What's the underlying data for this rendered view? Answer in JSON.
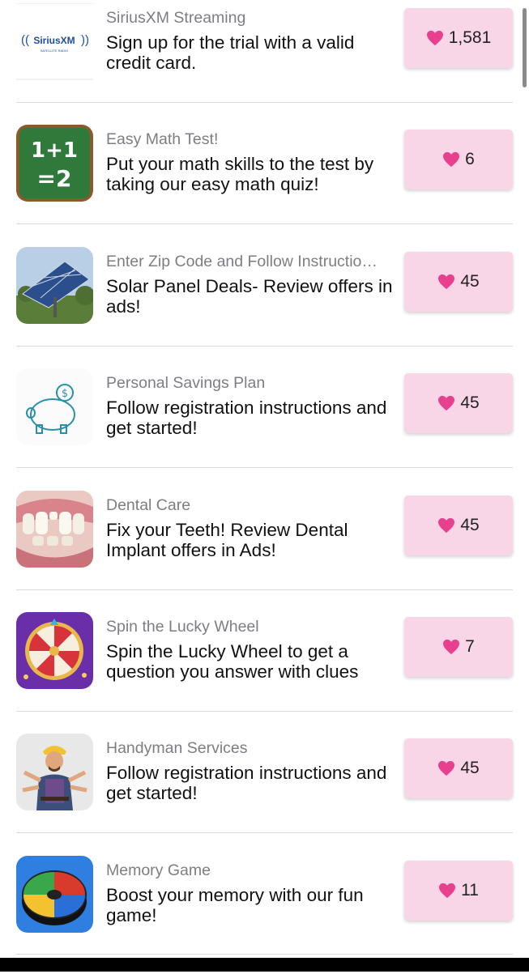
{
  "offers": [
    {
      "category": "SiriusXM Streaming",
      "description": "Sign up for the trial with a valid credit card.",
      "likes": "1,581",
      "icon": "siriusxm-logo-icon"
    },
    {
      "category": "Easy Math Test!",
      "description": "Put your math skills to the test by taking our easy math quiz!",
      "likes": "6",
      "icon": "math-chalkboard-icon"
    },
    {
      "category": "Enter Zip Code and Follow Instructio…",
      "description": "Solar Panel Deals- Review offers in ads!",
      "likes": "45",
      "icon": "solar-panel-icon"
    },
    {
      "category": "Personal Savings Plan",
      "description": "Follow registration instructions and get started!",
      "likes": "45",
      "icon": "piggy-bank-icon"
    },
    {
      "category": "Dental Care",
      "description": "Fix your Teeth! Review Dental Implant offers in Ads!",
      "likes": "45",
      "icon": "teeth-icon"
    },
    {
      "category": "Spin the Lucky Wheel",
      "description": "Spin the Lucky Wheel to get a question you answer with clues",
      "likes": "7",
      "icon": "lucky-wheel-icon"
    },
    {
      "category": "Handyman Services",
      "description": "Follow registration instructions and get started!",
      "likes": "45",
      "icon": "handyman-icon"
    },
    {
      "category": "Memory Game",
      "description": "Boost your memory with our fun game!",
      "likes": "11",
      "icon": "memory-game-icon"
    }
  ],
  "colors": {
    "badge_bg": "#f8d6e8",
    "heart": "#e8408f",
    "divider": "#d9d9d9",
    "category_text": "#7d7d86"
  },
  "logo_text": {
    "sirius": "SiriusXM",
    "sirius_sub": "SATELLITE RADIO",
    "math_top": "1+1",
    "math_bottom": "=2",
    "dollar": "$"
  }
}
